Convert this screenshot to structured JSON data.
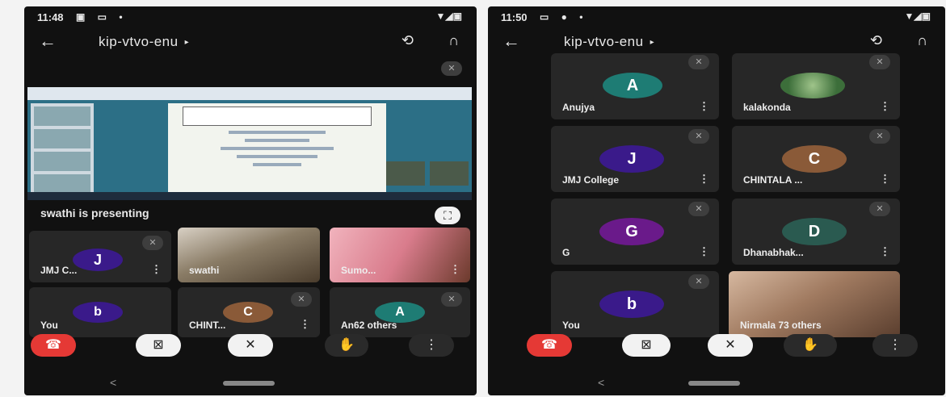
{
  "left_phone": {
    "status": {
      "time": "11:48",
      "icons": "▣ ▭ •",
      "right": "▼◢▣"
    },
    "room": {
      "name": "kip-vtvo-enu",
      "caret": "▸"
    },
    "icons": {
      "back": "back-arrow-icon",
      "switch": "camera-switch-icon",
      "audio": "headphones-icon"
    },
    "presenting_text": "swathi is presenting",
    "tiles": [
      {
        "type": "avatar",
        "letter": "J",
        "color": "#3a1a8a",
        "name": "JMJ C...",
        "more": "⋮"
      },
      {
        "type": "video",
        "color": "#7a6a56",
        "name": "swathi"
      },
      {
        "type": "video",
        "color": "#d4828e",
        "name": "Sumo...",
        "more": "⋮"
      },
      {
        "type": "avatar",
        "letter": "b",
        "color": "#3a1a8a",
        "name": "You"
      },
      {
        "type": "avatar",
        "letter": "C",
        "color": "#8a5a38",
        "name": "CHINT...",
        "more": "⋮"
      },
      {
        "type": "avatar",
        "letter": "A",
        "color": "#1e7c74",
        "name": "An",
        "others": "62 others"
      }
    ]
  },
  "right_phone": {
    "status": {
      "time": "11:50",
      "icons": "▭ ● •",
      "right": "▼◢▣"
    },
    "room": {
      "name": "kip-vtvo-enu",
      "caret": "▸"
    },
    "tiles": [
      {
        "type": "avatar",
        "letter": "A",
        "color": "#1e7c74",
        "name": "Anujya",
        "more": "⋮"
      },
      {
        "type": "photo",
        "color": "#3c6e3a",
        "name": "kalakonda",
        "more": "⋮"
      },
      {
        "type": "avatar",
        "letter": "J",
        "color": "#3a1a8a",
        "name": "JMJ College",
        "more": "⋮"
      },
      {
        "type": "avatar",
        "letter": "C",
        "color": "#8a5a38",
        "name": "CHINTALA ...",
        "more": "⋮"
      },
      {
        "type": "avatar",
        "letter": "G",
        "color": "#6a1a8a",
        "name": "G",
        "more": "⋮"
      },
      {
        "type": "avatar",
        "letter": "D",
        "color": "#2a5a50",
        "name": "Dhanabhak...",
        "more": "⋮"
      },
      {
        "type": "avatar",
        "letter": "b",
        "color": "#3a1a8a",
        "name": "You"
      },
      {
        "type": "video",
        "color": "#8a6e5a",
        "name": "Nirmala",
        "others": "73 others"
      }
    ]
  },
  "controls": {
    "end_call": {
      "icon": "end-call-icon",
      "glyph": "☎",
      "color": "#e53935"
    },
    "camera": {
      "icon": "camera-off-icon",
      "glyph": "⊠"
    },
    "mic": {
      "icon": "mic-off-icon",
      "glyph": "✕"
    },
    "hand": {
      "icon": "raise-hand-icon",
      "glyph": "✋"
    },
    "more": {
      "icon": "more-options-icon",
      "glyph": "⋮"
    }
  },
  "nav": {
    "back": "<"
  }
}
